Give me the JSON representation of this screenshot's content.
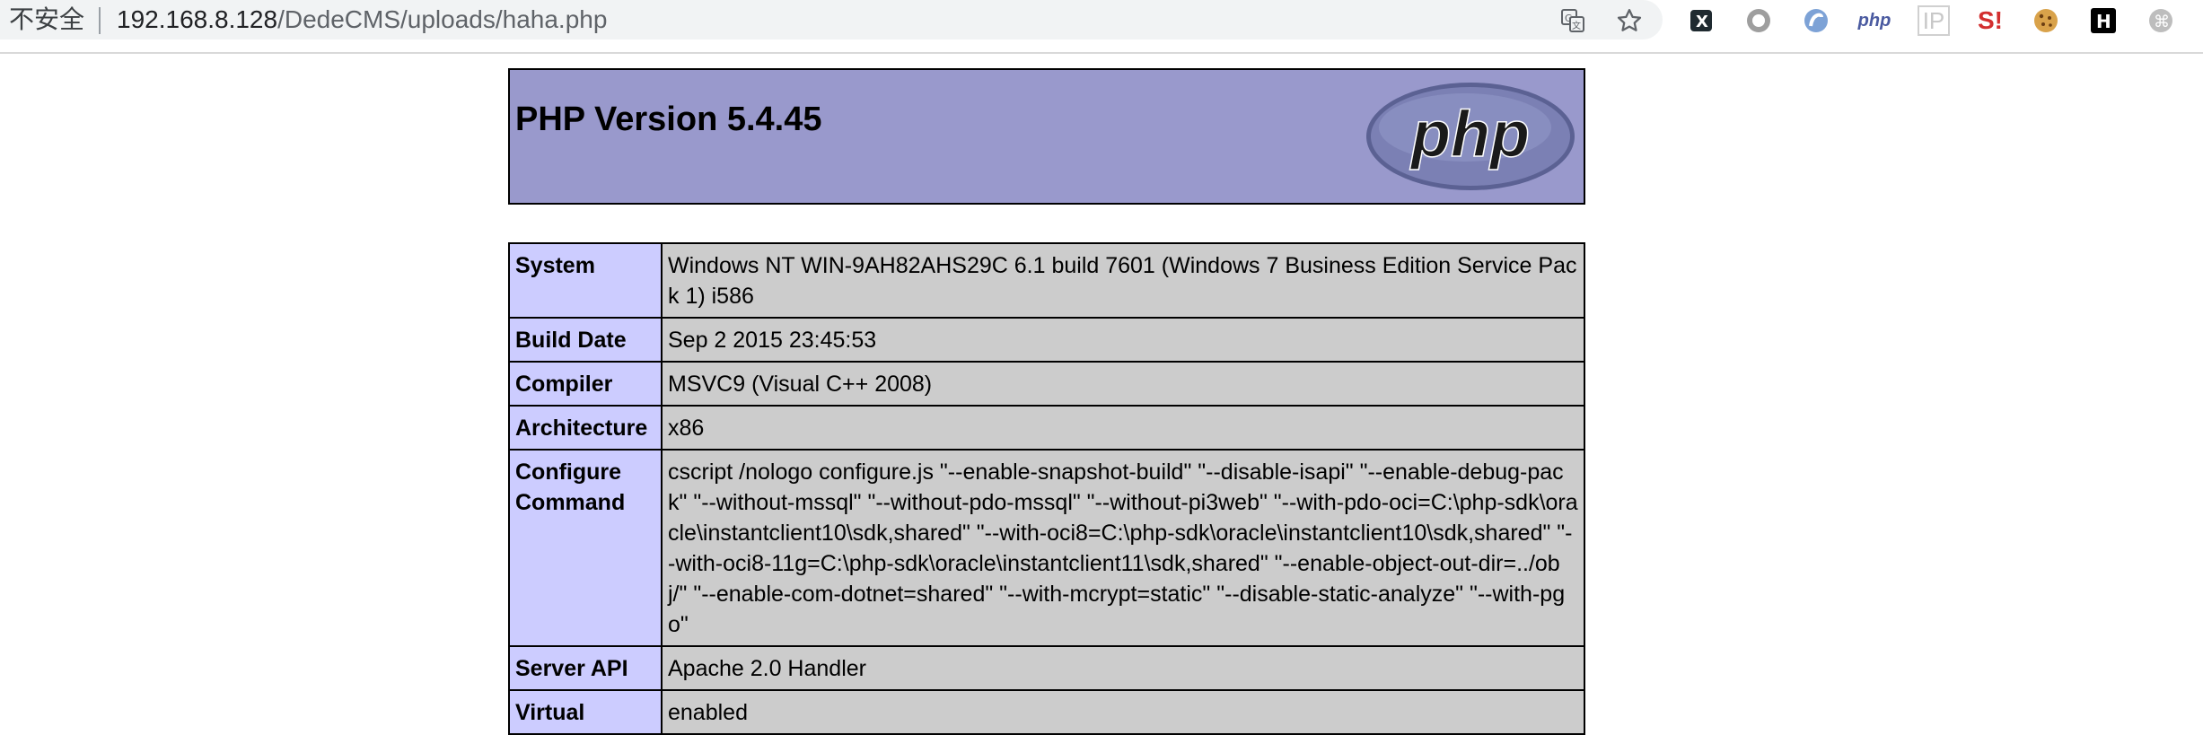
{
  "browser": {
    "security_label": "不安全",
    "url_host": "192.168.8.128",
    "url_path": "/DedeCMS/uploads/haha.php",
    "icons": [
      "translate-icon",
      "bookmark-star-icon"
    ],
    "extensions": [
      {
        "name": "x-extension-icon",
        "glyph": "X"
      },
      {
        "name": "circle-extension-icon",
        "glyph": "○"
      },
      {
        "name": "swirl-extension-icon",
        "glyph": "◐"
      },
      {
        "name": "php-extension-icon",
        "glyph": "php"
      },
      {
        "name": "ip-extension-icon",
        "glyph": "IP"
      },
      {
        "name": "s-extension-icon",
        "glyph": "S!"
      },
      {
        "name": "cookie-extension-icon",
        "glyph": "🍪"
      },
      {
        "name": "h-extension-icon",
        "glyph": "H"
      },
      {
        "name": "cmd-extension-icon",
        "glyph": "⌘"
      }
    ]
  },
  "page": {
    "title": "PHP Version 5.4.45",
    "logo_text": "php",
    "header_color": "#9999cc",
    "rows": [
      {
        "label": "System",
        "value": "Windows NT WIN-9AH82AHS29C 6.1 build 7601 (Windows 7 Business Edition Service Pack 1) i586"
      },
      {
        "label": "Build Date",
        "value": "Sep 2 2015 23:45:53"
      },
      {
        "label": "Compiler",
        "value": "MSVC9 (Visual C++ 2008)"
      },
      {
        "label": "Architecture",
        "value": "x86"
      },
      {
        "label": "Configure Command",
        "value": "cscript /nologo configure.js \"--enable-snapshot-build\" \"--disable-isapi\" \"--enable-debug-pack\" \"--without-mssql\" \"--without-pdo-mssql\" \"--without-pi3web\" \"--with-pdo-oci=C:\\php-sdk\\oracle\\instantclient10\\sdk,shared\" \"--with-oci8=C:\\php-sdk\\oracle\\instantclient10\\sdk,shared\" \"--with-oci8-11g=C:\\php-sdk\\oracle\\instantclient11\\sdk,shared\" \"--enable-object-out-dir=../obj/\" \"--enable-com-dotnet=shared\" \"--with-mcrypt=static\" \"--disable-static-analyze\" \"--with-pgo\""
      },
      {
        "label": "Server API",
        "value": "Apache 2.0 Handler"
      },
      {
        "label": "Virtual",
        "value": "enabled"
      }
    ]
  }
}
